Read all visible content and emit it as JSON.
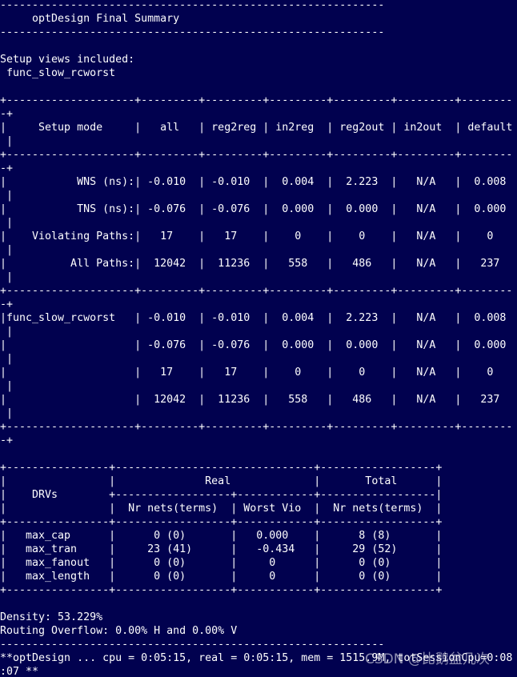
{
  "terminal": {
    "background": "#01014f",
    "foreground": "#ffffff",
    "lines": [
      "------------------------------------------------------------",
      "     optDesign Final Summary",
      "------------------------------------------------------------",
      "",
      "Setup views included:",
      " func_slow_rcworst",
      "",
      "+--------------------+---------+---------+---------+---------+---------+--------",
      "-+",
      "|     Setup mode     |   all   | reg2reg | in2reg  | reg2out | in2out  | default",
      " |",
      "+--------------------+---------+---------+---------+---------+---------+--------",
      "-+",
      "|           WNS (ns):| -0.010  | -0.010  |  0.004  |  2.223  |   N/A   |  0.008",
      " |",
      "|           TNS (ns):| -0.076  | -0.076  |  0.000  |  0.000  |   N/A   |  0.000",
      " |",
      "|    Violating Paths:|   17    |   17    |    0    |    0    |   N/A   |    0",
      " |",
      "|          All Paths:|  12042  |  11236  |   558   |   486   |   N/A   |   237",
      " |",
      "+--------------------+---------+---------+---------+---------+---------+--------",
      "-+",
      "|func_slow_rcworst   | -0.010  | -0.010  |  0.004  |  2.223  |   N/A   |  0.008",
      " |",
      "|                    | -0.076  | -0.076  |  0.000  |  0.000  |   N/A   |  0.000",
      " |",
      "|                    |   17    |   17    |    0    |    0    |   N/A   |    0",
      " |",
      "|                    |  12042  |  11236  |   558   |   486   |   N/A   |   237",
      " |",
      "+--------------------+---------+---------+---------+---------+---------+--------",
      "-+",
      "",
      "+----------------+-------------------------------+------------------+",
      "|                |              Real             |       Total      |",
      "|    DRVs        +------------------+------------+------------------|",
      "|                |  Nr nets(terms)  | Worst Vio  |  Nr nets(terms)  |",
      "+----------------+------------------+------------+------------------+",
      "|   max_cap      |      0 (0)       |   0.000    |      8 (8)       |",
      "|   max_tran     |     23 (41)      |   -0.434   |     29 (52)      |",
      "|   max_fanout   |      0 (0)       |     0      |      0 (0)       |",
      "|   max_length   |      0 (0)       |     0      |      0 (0)       |",
      "+----------------+------------------+------------+------------------+",
      "",
      "Density: 53.229%",
      "Routing Overflow: 0.00% H and 0.00% V",
      "------------------------------------------------------------",
      "**optDesign ... cpu = 0:05:15, real = 0:05:15, mem = 1515.9M, totSessionCpu=0:08",
      ":07 **"
    ]
  },
  "watermark": {
    "text": "CSDN @比鹅盆几次"
  }
}
